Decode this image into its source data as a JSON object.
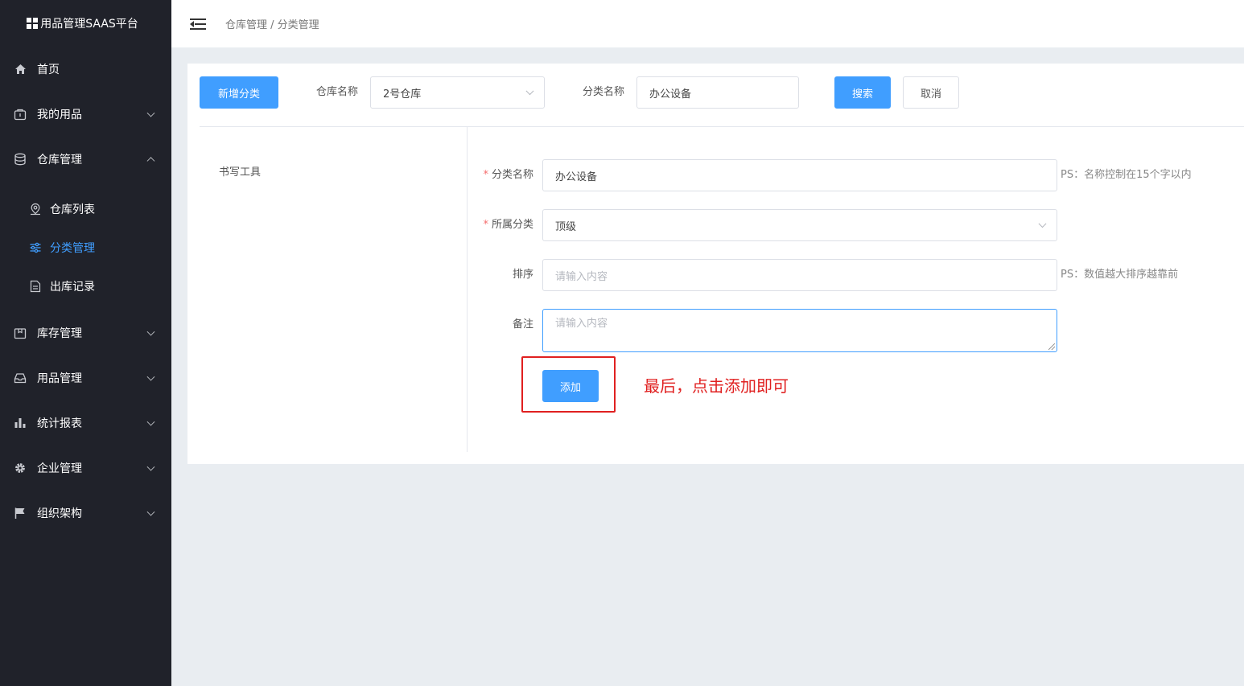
{
  "app": {
    "title": "用品管理SAAS平台"
  },
  "sidebar": {
    "items": [
      {
        "label": "首页",
        "icon": "home-icon"
      },
      {
        "label": "我的用品",
        "icon": "bag-icon"
      },
      {
        "label": "仓库管理",
        "icon": "database-icon",
        "expanded": true
      },
      {
        "label": "库存管理",
        "icon": "box-icon"
      },
      {
        "label": "用品管理",
        "icon": "inbox-icon"
      },
      {
        "label": "统计报表",
        "icon": "bar-chart-icon"
      },
      {
        "label": "企业管理",
        "icon": "gear-icon"
      },
      {
        "label": "组织架构",
        "icon": "flag-icon"
      }
    ],
    "warehouse_sub": [
      {
        "label": "仓库列表",
        "icon": "location-pin-icon"
      },
      {
        "label": "分类管理",
        "icon": "sliders-icon",
        "active": true
      },
      {
        "label": "出库记录",
        "icon": "document-icon"
      }
    ]
  },
  "header": {
    "breadcrumb": "仓库管理 / 分类管理"
  },
  "toolbar": {
    "add_button": "新增分类",
    "warehouse_label": "仓库名称",
    "warehouse_value": "2号仓库",
    "category_label": "分类名称",
    "category_value": "办公设备",
    "search_button": "搜索",
    "cancel_button": "取消"
  },
  "tree": {
    "items": [
      "书写工具"
    ]
  },
  "form": {
    "name_label": "分类名称",
    "name_value": "办公设备",
    "name_hint": "PS：名称控制在15个字以内",
    "parent_label": "所属分类",
    "parent_value": "顶级",
    "sort_label": "排序",
    "sort_placeholder": "请输入内容",
    "sort_hint": "PS：数值越大排序越靠前",
    "remark_label": "备注",
    "remark_placeholder": "请输入内容",
    "submit_button": "添加"
  },
  "annotation": {
    "text": "最后，点击添加即可",
    "color": "#e02020"
  },
  "colors": {
    "primary": "#409eff",
    "sidebar_bg": "#20222a",
    "required": "#f56c6c"
  }
}
